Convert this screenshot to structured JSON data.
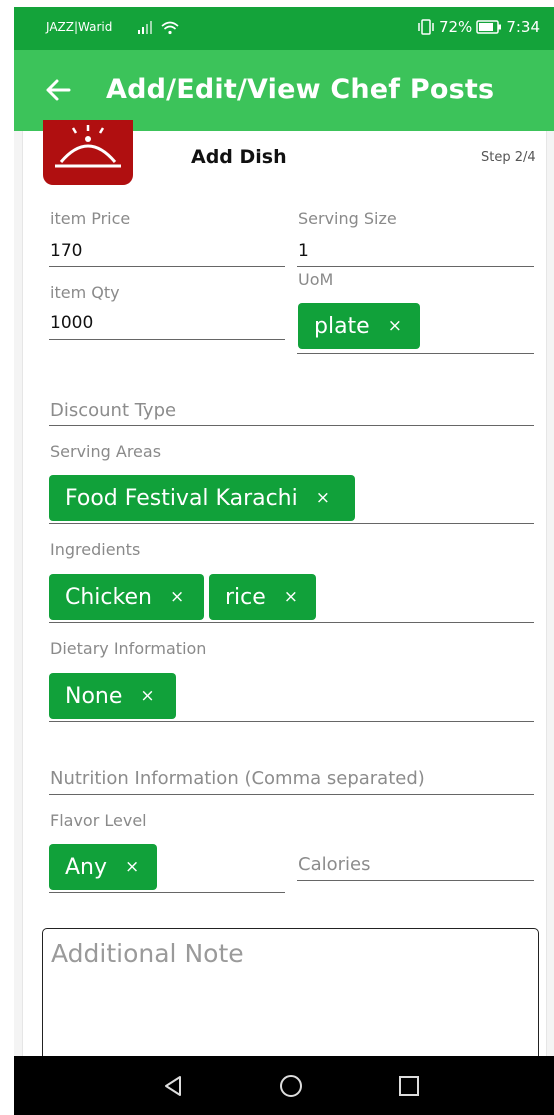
{
  "status": {
    "carrier": "JAZZ|Warid",
    "battery": "72%",
    "time": "7:34"
  },
  "app_bar": {
    "title": "Add/Edit/View Chef Posts"
  },
  "form": {
    "heading": "Add Dish",
    "step": "Step 2/4",
    "item_price": {
      "label": "item Price",
      "value": "170"
    },
    "serving_size": {
      "label": "Serving Size",
      "value": "1"
    },
    "item_qty": {
      "label": "item Qty",
      "value": "1000"
    },
    "uom": {
      "label": "UoM",
      "chips": [
        "plate"
      ]
    },
    "discount_type": {
      "placeholder": "Discount Type"
    },
    "serving_areas": {
      "label": "Serving Areas",
      "chips": [
        "Food Festival Karachi"
      ]
    },
    "ingredients": {
      "label": "Ingredients",
      "chips": [
        "Chicken",
        "rice"
      ]
    },
    "dietary": {
      "label": "Dietary Information",
      "chips": [
        "None"
      ]
    },
    "nutrition": {
      "placeholder": "Nutrition Information (Comma separated)"
    },
    "flavor": {
      "label": "Flavor Level",
      "chips": [
        "Any"
      ]
    },
    "calories": {
      "placeholder": "Calories"
    },
    "note": {
      "placeholder": "Additional Note"
    },
    "chip_remove_glyph": "×"
  },
  "colors": {
    "status_bar": "#14a33a",
    "app_bar": "#3cc35a",
    "chip": "#11a13a",
    "logo": "#b00f10"
  }
}
